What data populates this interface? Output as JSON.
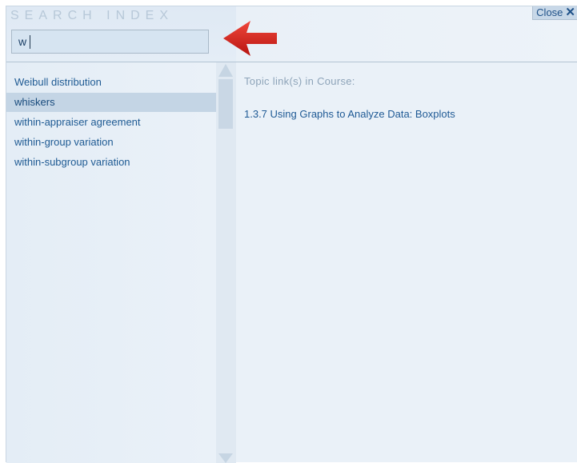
{
  "header": {
    "title": "SEARCH INDEX",
    "close_label": "Close",
    "close_icon": "close-icon"
  },
  "search": {
    "value": "w",
    "placeholder": ""
  },
  "index": {
    "items": [
      {
        "label": "Weibull distribution",
        "selected": false
      },
      {
        "label": "whiskers",
        "selected": true
      },
      {
        "label": "within-appraiser agreement",
        "selected": false
      },
      {
        "label": "within-group variation",
        "selected": false
      },
      {
        "label": "within-subgroup variation",
        "selected": false
      }
    ]
  },
  "detail": {
    "heading": "Topic link(s) in Course:",
    "links": [
      "1.3.7 Using Graphs to Analyze Data: Boxplots"
    ]
  },
  "colors": {
    "accent_arrow": "#d2241b",
    "link": "#1e5a93",
    "selected_bg": "#c4d5e5"
  },
  "icons": {
    "arrow": "red-left-arrow-icon",
    "scroll_up": "scroll-up-arrow-icon",
    "scroll_down": "scroll-down-arrow-icon"
  }
}
